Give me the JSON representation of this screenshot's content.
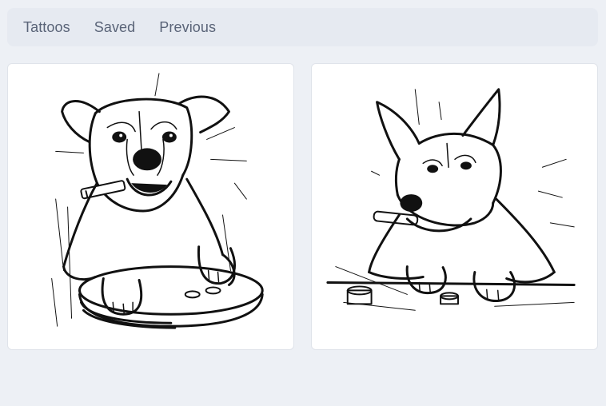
{
  "nav": {
    "tabs": [
      {
        "label": "Tattoos"
      },
      {
        "label": "Saved"
      },
      {
        "label": "Previous"
      }
    ]
  },
  "gallery": {
    "items": [
      {
        "icon": "boxer-dog-smoking-sketch"
      },
      {
        "icon": "shepherd-dog-smoking-sketch"
      }
    ]
  }
}
